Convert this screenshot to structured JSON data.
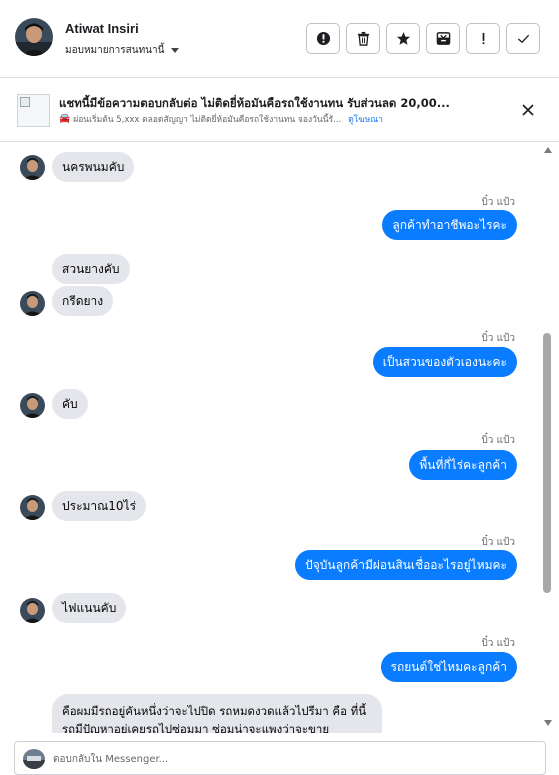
{
  "header": {
    "user_name": "Atiwat Insiri",
    "assign_label": "มอบหมายการสนทนานี้",
    "actions": [
      {
        "name": "mark-spam-button",
        "icon": "alert-circle-icon"
      },
      {
        "name": "delete-button",
        "icon": "trash-icon"
      },
      {
        "name": "star-button",
        "icon": "star-icon"
      },
      {
        "name": "archive-button",
        "icon": "archive-icon"
      },
      {
        "name": "follow-up-button",
        "icon": "exclamation-icon"
      },
      {
        "name": "done-button",
        "icon": "check-icon"
      }
    ]
  },
  "ad": {
    "title": "แชทนี้มีข้อความตอบกลับต่อ ไม่ติดยี่ห้อมันคือรถใช้งานทน รับส่วนลด 20,00...",
    "subtitle": "ผ่อนเริ่มต้น 5,xxx ตลอดสัญญา ไม่ติดยี่ห้อมันคือรถใช้งานทน จองวันนี้รั...",
    "promo_label": "ดูโฆษณา"
  },
  "messages": [
    {
      "dir": "in",
      "text": "นครพนมคับ"
    },
    {
      "dir": "out",
      "sender": "บิ๋ว แป้ว",
      "text": "ลูกค้าทำอาชีพอะไรคะ"
    },
    {
      "dir": "in",
      "text": "สวนยางคับ"
    },
    {
      "dir": "in",
      "text": "กรีดยาง"
    },
    {
      "dir": "out",
      "sender": "บิ๋ว แป้ว",
      "text": "เป็นสวนของตัวเองนะคะ"
    },
    {
      "dir": "in",
      "text": "คับ"
    },
    {
      "dir": "out",
      "sender": "บิ๋ว แป้ว",
      "text": "พื้นที่กี่ไร่คะลูกค้า"
    },
    {
      "dir": "in",
      "text": "ประมาณ10ไร่"
    },
    {
      "dir": "out",
      "sender": "บิ๋ว แป้ว",
      "text": "ปัจุบันลูกค้ามีผ่อนสินเชื่ออะไรอยู่ไหมคะ"
    },
    {
      "dir": "in",
      "text": "ไฟแนนคับ"
    },
    {
      "dir": "out",
      "sender": "บิ๋ว แป้ว",
      "text": "รถยนต์ใช่ไหมคะลูกค้า"
    },
    {
      "dir": "in",
      "text": "คือผมมีรถอยู่คันหนึ่งว่าจะไปปิด รถหมดงวดแล้วไปรีมา คือ ที่นี้รถมีปัญหาอยู่เคยรถไปซ่อมมา ซ่อมน่าจะแพงว่าจะขาย"
    }
  ],
  "composer": {
    "placeholder": "ตอบกลับใน Messenger..."
  },
  "colors": {
    "outgoing_bubble": "#0a7cff",
    "incoming_bubble": "#e4e6eb"
  }
}
